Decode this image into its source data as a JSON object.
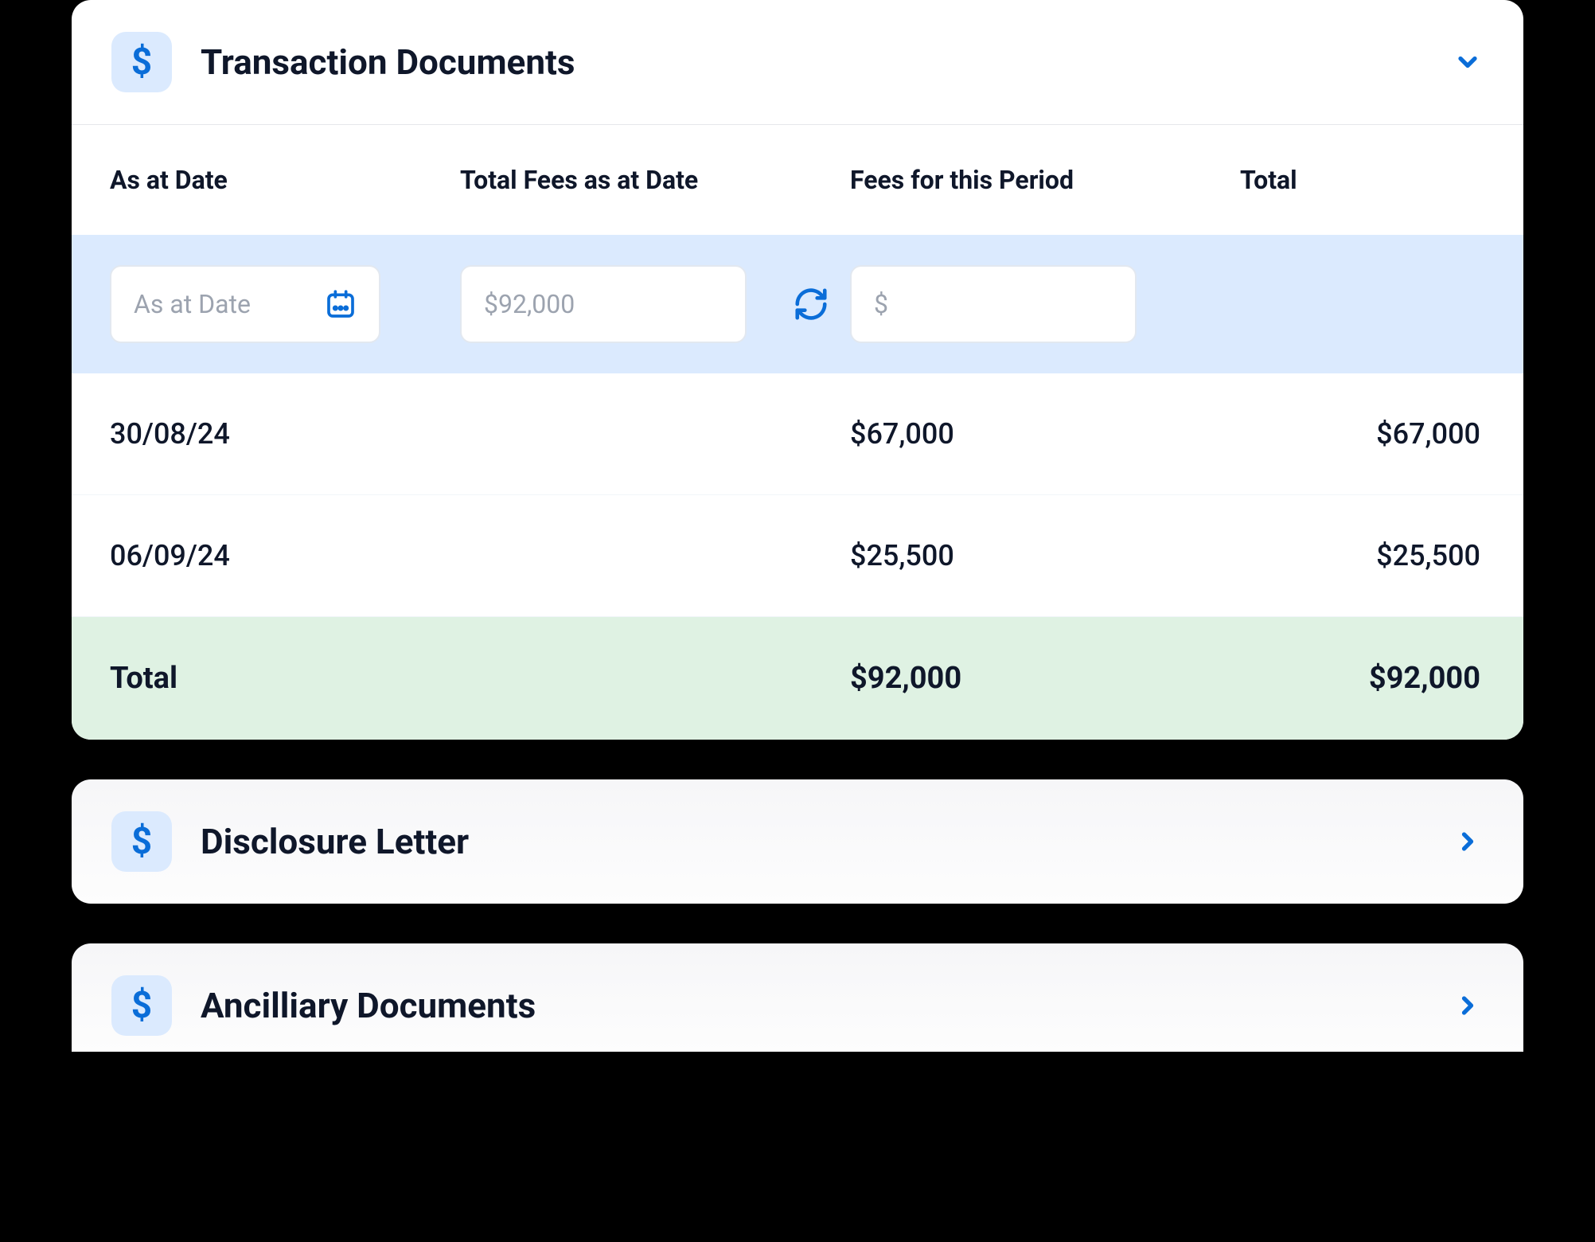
{
  "panels": [
    {
      "title": "Transaction Documents",
      "expanded": true,
      "table": {
        "headers": [
          "As at Date",
          "Total Fees as at Date",
          "Fees for this Period",
          "Total"
        ],
        "inputs": {
          "date_placeholder": "As at Date",
          "total_fees_value": "$92,000",
          "period_fee_value": "$"
        },
        "rows": [
          {
            "date": "30/08/24",
            "total_fees": "",
            "period_fee": "$67,000",
            "total": "$67,000"
          },
          {
            "date": "06/09/24",
            "total_fees": "",
            "period_fee": "$25,500",
            "total": "$25,500"
          }
        ],
        "total_row": {
          "label": "Total",
          "period_fee": "$92,000",
          "total": "$92,000"
        }
      }
    },
    {
      "title": "Disclosure Letter",
      "expanded": false
    },
    {
      "title": "Ancilliary Documents",
      "expanded": false
    }
  ]
}
